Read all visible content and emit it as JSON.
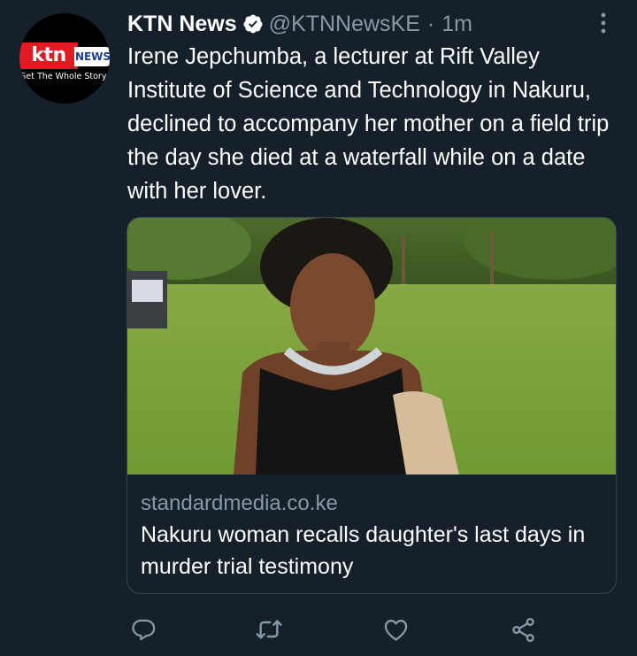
{
  "tweet": {
    "author_name": "KTN News",
    "handle": "@KTNNewsKE",
    "separator": "·",
    "time": "1m",
    "text": "Irene Jepchumba, a lecturer at Rift Valley Institute of Science and Technology in Nakuru, declined to accompany her mother on a field trip the day she died at a waterfall while on a date with her lover."
  },
  "avatar": {
    "logo_text": "ktn",
    "logo_badge": "NEWS",
    "tagline": "Get The Whole Story"
  },
  "card": {
    "domain": "standardmedia.co.ke",
    "title": "Nakuru woman recalls daughter's last days in murder trial testimony"
  },
  "actions": {
    "reply_icon": "reply-icon",
    "retweet_icon": "retweet-icon",
    "like_icon": "like-icon",
    "share_icon": "share-icon"
  },
  "colors": {
    "background": "#15202b",
    "secondary_text": "#8899a6",
    "border": "#38444d",
    "ktn_red": "#e21b22"
  }
}
